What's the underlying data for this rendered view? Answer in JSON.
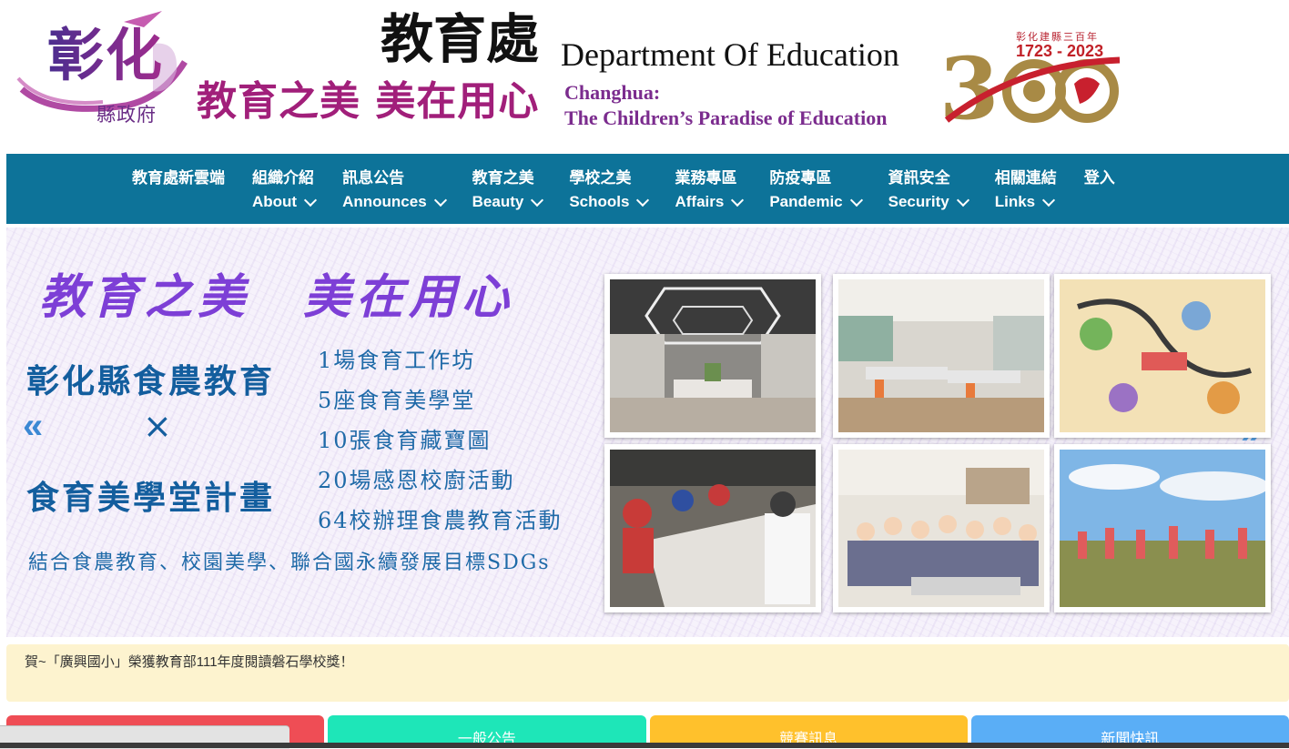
{
  "header": {
    "logo_main": "彰化",
    "logo_sub": "縣政府",
    "dept_cn": "教育處",
    "dept_en": "Department Of Education",
    "slogan": "教育之美 美在用心",
    "city_en_line1": "Changhua:",
    "city_en_line2": "The Children’s Paradise of Education",
    "anniversary_title": "彰化建縣三百年",
    "anniversary_years": "1723 - 2023"
  },
  "nav": {
    "items": [
      {
        "cn": "教育處新雲端",
        "en": ""
      },
      {
        "cn": "組織介紹",
        "en": "About"
      },
      {
        "cn": "訊息公告",
        "en": "Announces"
      },
      {
        "cn": "教育之美",
        "en": "Beauty"
      },
      {
        "cn": "學校之美",
        "en": "Schools"
      },
      {
        "cn": "業務專區",
        "en": "Affairs"
      },
      {
        "cn": "防疫專區",
        "en": "Pandemic"
      },
      {
        "cn": "資訊安全",
        "en": "Security"
      },
      {
        "cn": "相關連結",
        "en": "Links"
      },
      {
        "cn": "登入",
        "en": ""
      }
    ]
  },
  "banner": {
    "title": "教育之美　美在用心",
    "left_line1": "彰化縣食農教育",
    "times": "×",
    "left_line2": "食育美學堂計畫",
    "list": [
      "1場食育工作坊",
      "5座食育美學堂",
      "10張食育藏寶圖",
      "20場感恩校廚活動",
      "64校辦理食農教育活動"
    ],
    "footer": "結合食農教育、校園美學、聯合國永續發展目標SDGs",
    "prev": "«",
    "next": "»"
  },
  "marquee": {
    "text": "賀~「廣興國小」榮獲教育部111年度閱讀磐石學校獎！"
  },
  "tabs": [
    "",
    "一般公告",
    "競賽訊息",
    "新聞快訊"
  ],
  "colors": {
    "nav_bg": "#0d7399",
    "tab_red": "#ef4d55",
    "tab_green": "#1ee6b8",
    "tab_yellow": "#ffc12c",
    "tab_blue": "#5aaef6"
  }
}
